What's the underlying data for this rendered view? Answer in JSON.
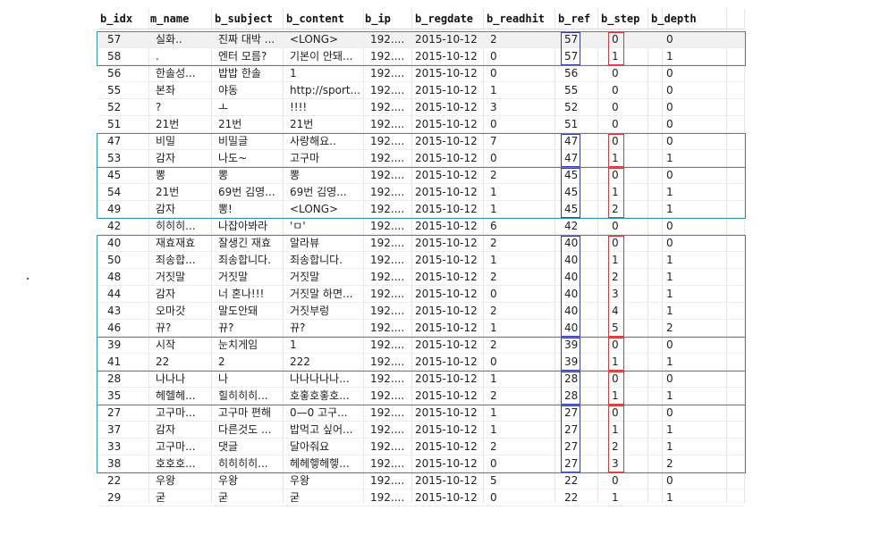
{
  "columns": [
    "b_idx",
    "m_name",
    "b_subject",
    "b_content",
    "b_ip",
    "b_regdate",
    "b_readhit",
    "b_ref",
    "b_step",
    "b_depth"
  ],
  "rows": [
    [
      "57",
      "실화..",
      "진짜 대박 ...",
      "<LONG>",
      "192....",
      "2015-10-12",
      "2",
      "57",
      "0",
      "0"
    ],
    [
      "58",
      ".",
      "엔터 모름?",
      "기본이 안돼...",
      "192....",
      "2015-10-12",
      "0",
      "57",
      "1",
      "1"
    ],
    [
      "56",
      "한솔성...",
      "밥밥 한솔",
      "1",
      "192....",
      "2015-10-12",
      "0",
      "56",
      "0",
      "0"
    ],
    [
      "55",
      "본좌",
      "야동",
      "http://sport...",
      "192....",
      "2015-10-12",
      "1",
      "55",
      "0",
      "0"
    ],
    [
      "52",
      "?",
      "ㅗ",
      "!!!!",
      "192....",
      "2015-10-12",
      "3",
      "52",
      "0",
      "0"
    ],
    [
      "51",
      "21번",
      "21번",
      "21번",
      "192....",
      "2015-10-12",
      "0",
      "51",
      "0",
      "0"
    ],
    [
      "47",
      "비밀",
      "비밀글",
      "사랑해요..",
      "192....",
      "2015-10-12",
      "7",
      "47",
      "0",
      "0"
    ],
    [
      "53",
      "감자",
      "나도~",
      "고구마",
      "192....",
      "2015-10-12",
      "0",
      "47",
      "1",
      "1"
    ],
    [
      "45",
      "뽕",
      "뽕",
      "뽕",
      "192....",
      "2015-10-12",
      "2",
      "45",
      "0",
      "0"
    ],
    [
      "54",
      "21번",
      "69번 김영...",
      "69번 김영...",
      "192....",
      "2015-10-12",
      "1",
      "45",
      "1",
      "1"
    ],
    [
      "49",
      "감자",
      "뽕!",
      "<LONG>",
      "192....",
      "2015-10-12",
      "1",
      "45",
      "2",
      "1"
    ],
    [
      "42",
      "히히히...",
      "나잡아봐라",
      "'ㅁ'",
      "192....",
      "2015-10-12",
      "6",
      "42",
      "0",
      "0"
    ],
    [
      "40",
      "재효재효",
      "잘생긴 재효",
      "알라뷰",
      "192....",
      "2015-10-12",
      "2",
      "40",
      "0",
      "0"
    ],
    [
      "50",
      "죄송합...",
      "죄송합니다.",
      "죄송합니다.",
      "192....",
      "2015-10-12",
      "1",
      "40",
      "1",
      "1"
    ],
    [
      "48",
      "거짓말",
      "거짓말",
      "거짓말",
      "192....",
      "2015-10-12",
      "2",
      "40",
      "2",
      "1"
    ],
    [
      "44",
      "감자",
      "너 혼나!!!",
      "거짓말 하면...",
      "192....",
      "2015-10-12",
      "0",
      "40",
      "3",
      "1"
    ],
    [
      "43",
      "오마갓",
      "말도안돼",
      "거짓부렁",
      "192....",
      "2015-10-12",
      "2",
      "40",
      "4",
      "1"
    ],
    [
      "46",
      "뀨?",
      "뀨?",
      "뀨?",
      "192....",
      "2015-10-12",
      "1",
      "40",
      "5",
      "2"
    ],
    [
      "39",
      "시작",
      "눈치게임",
      "1",
      "192....",
      "2015-10-12",
      "2",
      "39",
      "0",
      "0"
    ],
    [
      "41",
      "22",
      "2",
      "222",
      "192....",
      "2015-10-12",
      "0",
      "39",
      "1",
      "1"
    ],
    [
      "28",
      "나나나",
      "나",
      "나나나나나...",
      "192....",
      "2015-10-12",
      "1",
      "28",
      "0",
      "0"
    ],
    [
      "35",
      "헤헬헤...",
      "힐히히히...",
      "호홓호홓호...",
      "192....",
      "2015-10-12",
      "2",
      "28",
      "1",
      "1"
    ],
    [
      "27",
      "고구마...",
      "고구마 편해",
      "0—0 고구...",
      "192....",
      "2015-10-12",
      "1",
      "27",
      "0",
      "0"
    ],
    [
      "37",
      "감자",
      "다른것도 ...",
      "밥먹고 싶어...",
      "192....",
      "2015-10-12",
      "1",
      "27",
      "1",
      "1"
    ],
    [
      "33",
      "고구마...",
      "댓글",
      "달아줘요",
      "192....",
      "2015-10-12",
      "2",
      "27",
      "2",
      "1"
    ],
    [
      "38",
      "호호호...",
      "히히히히...",
      "헤헤헿헤헿...",
      "192....",
      "2015-10-12",
      "0",
      "27",
      "3",
      "2"
    ],
    [
      "22",
      "우왕",
      "우왕",
      "우왕",
      "192....",
      "2015-10-12",
      "5",
      "22",
      "0",
      "0"
    ],
    [
      "29",
      "굳",
      "굳",
      "굳",
      "192....",
      "2015-10-12",
      "0",
      "22",
      "1",
      "1"
    ]
  ],
  "colors": {
    "group_border": "#2a93b8",
    "ref_border": "#3b3fa8",
    "step_border": "#d43a3a"
  }
}
